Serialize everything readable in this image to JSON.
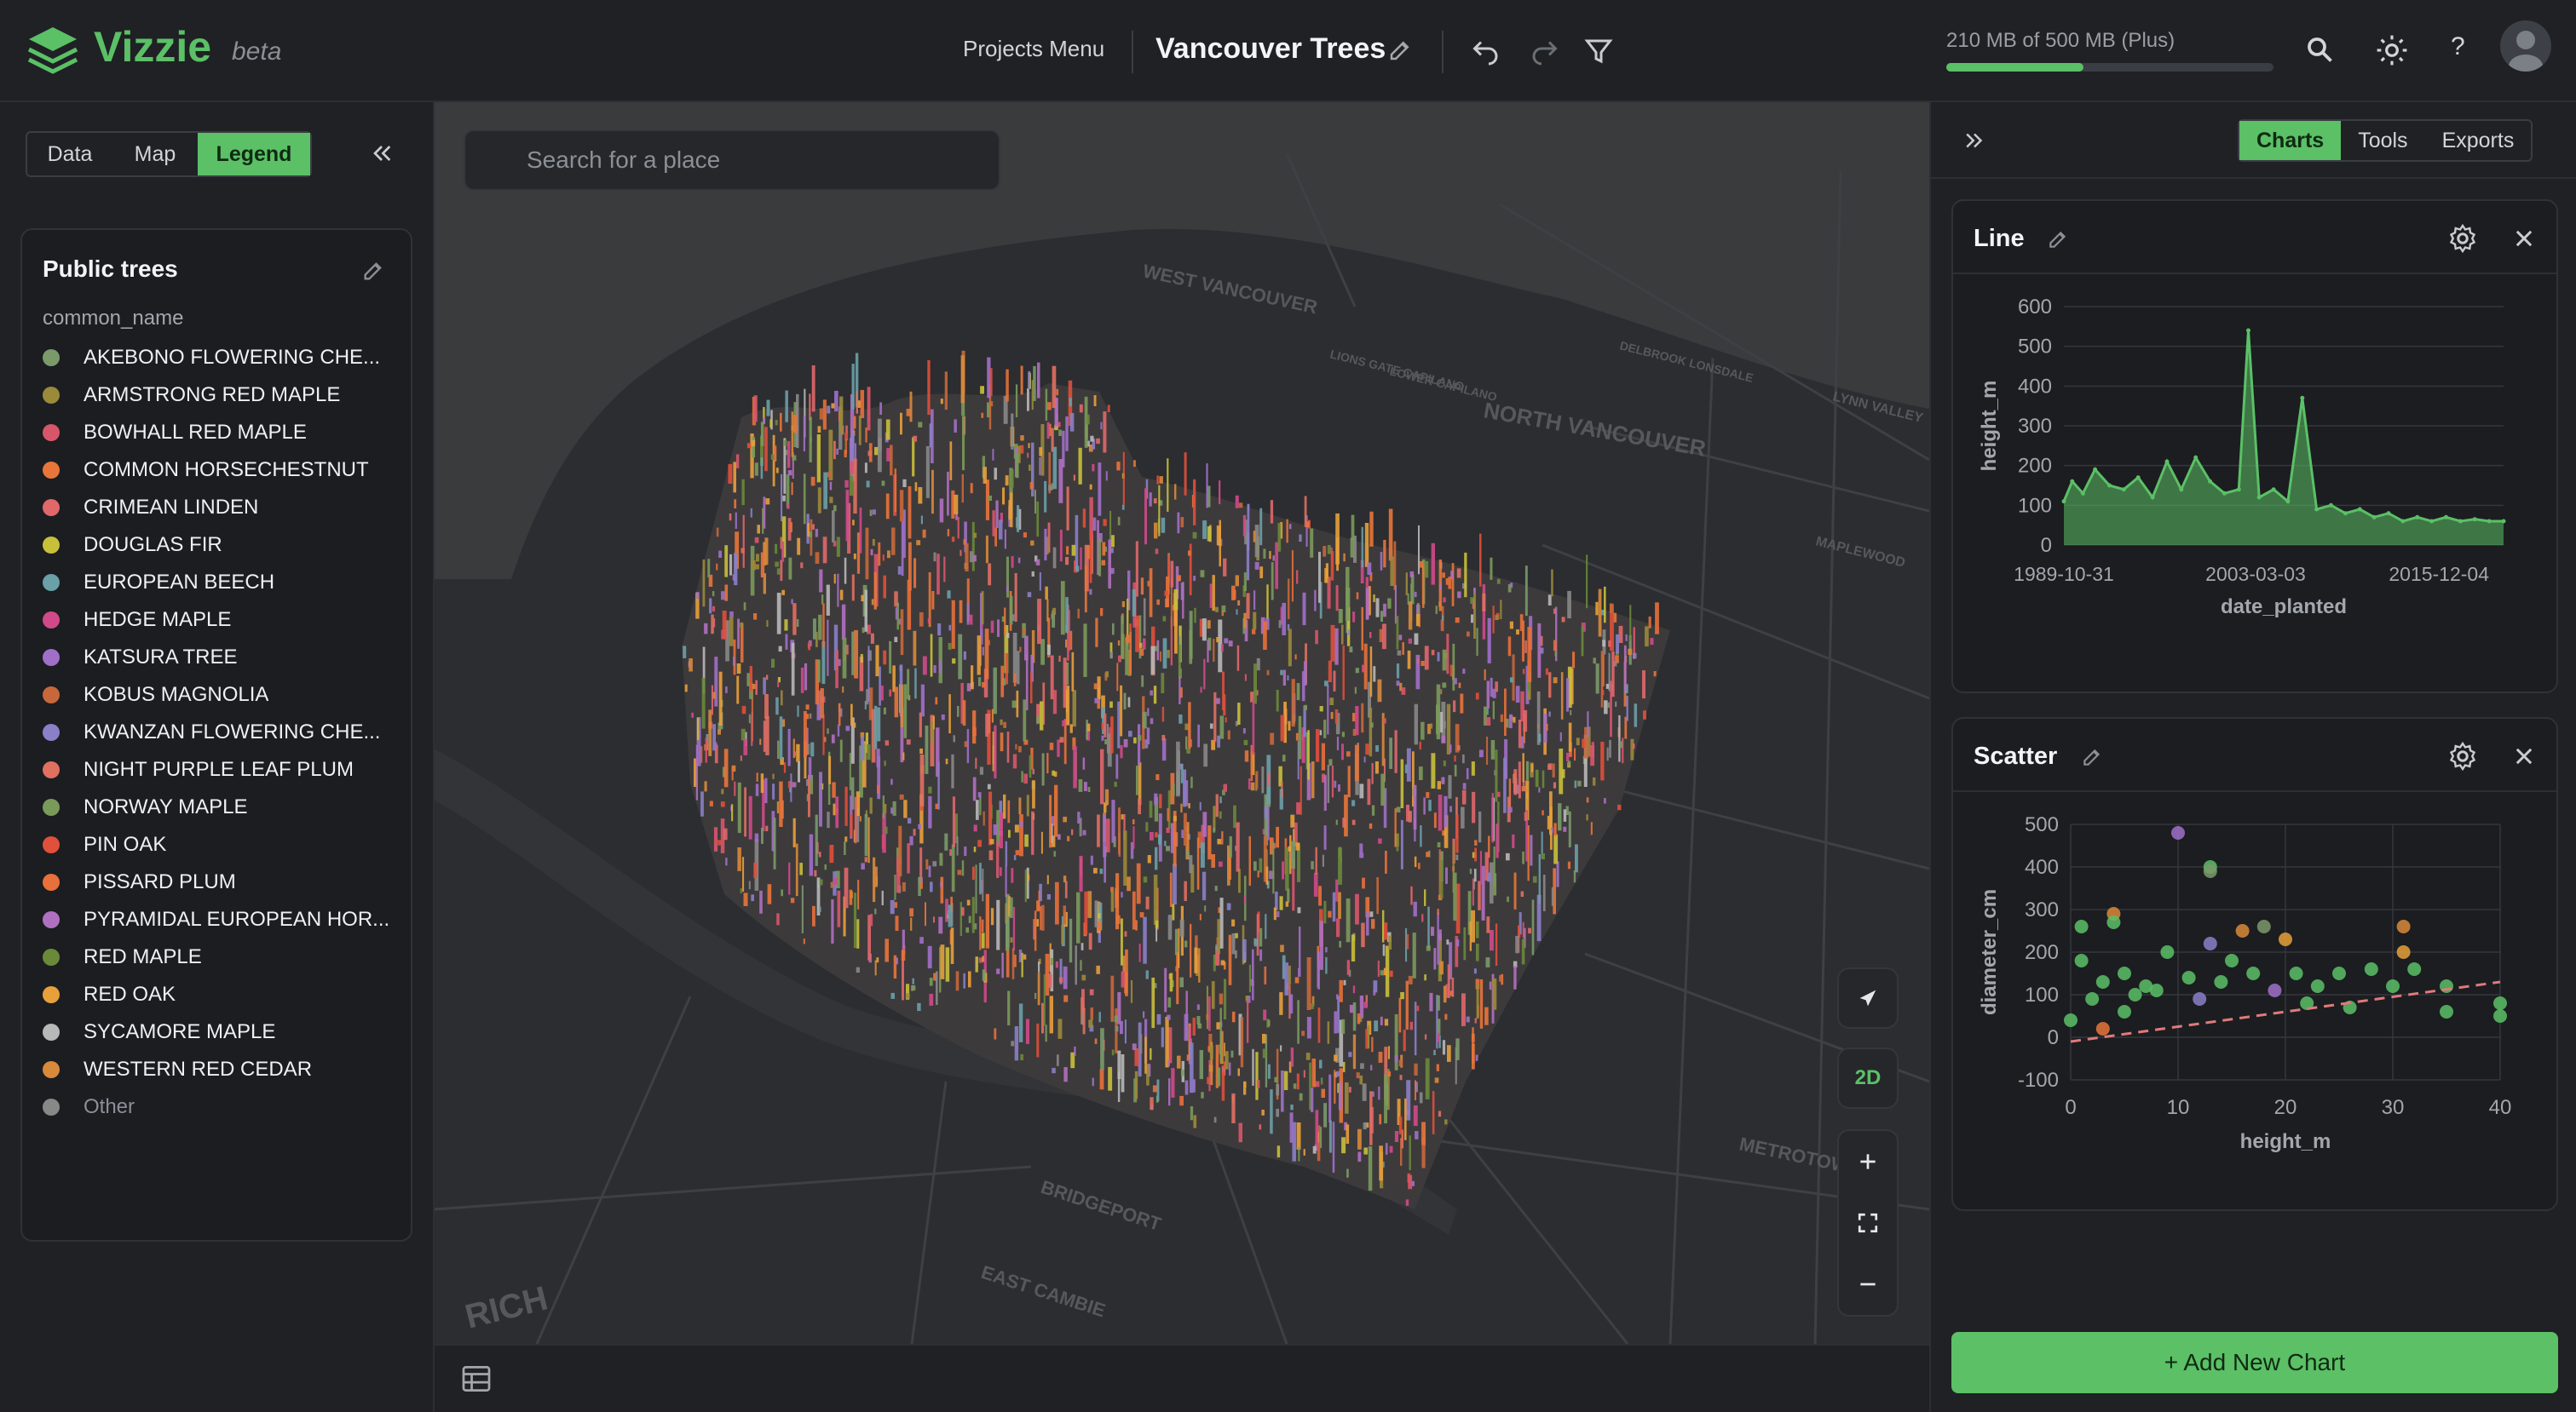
{
  "app": {
    "name": "Vizzie",
    "badge": "beta"
  },
  "header": {
    "projects_menu": "Projects Menu",
    "project_title": "Vancouver Trees",
    "storage_text": "210 MB of 500 MB (Plus)",
    "storage_used_fraction": 0.42
  },
  "left_tabs": [
    {
      "label": "Data",
      "active": false
    },
    {
      "label": "Map",
      "active": false
    },
    {
      "label": "Legend",
      "active": true
    }
  ],
  "legend": {
    "title": "Public trees",
    "field": "common_name",
    "items": [
      {
        "label": "AKEBONO FLOWERING CHE...",
        "color": "#7a9a6a"
      },
      {
        "label": "ARMSTRONG RED MAPLE",
        "color": "#9a8a3a"
      },
      {
        "label": "BOWHALL RED MAPLE",
        "color": "#d8566a"
      },
      {
        "label": "COMMON HORSECHESTNUT",
        "color": "#e8763a"
      },
      {
        "label": "CRIMEAN LINDEN",
        "color": "#e0686a"
      },
      {
        "label": "DOUGLAS FIR",
        "color": "#c8c03a"
      },
      {
        "label": "EUROPEAN BEECH",
        "color": "#6aa0a8"
      },
      {
        "label": "HEDGE MAPLE",
        "color": "#d04a8a"
      },
      {
        "label": "KATSURA TREE",
        "color": "#a070c8"
      },
      {
        "label": "KOBUS MAGNOLIA",
        "color": "#c8683a"
      },
      {
        "label": "KWANZAN FLOWERING CHE...",
        "color": "#8a80c8"
      },
      {
        "label": "NIGHT PURPLE LEAF PLUM",
        "color": "#e07060"
      },
      {
        "label": "NORWAY MAPLE",
        "color": "#7a9a5a"
      },
      {
        "label": "PIN OAK",
        "color": "#e0503a"
      },
      {
        "label": "PISSARD PLUM",
        "color": "#e8703a"
      },
      {
        "label": "PYRAMIDAL EUROPEAN HOR...",
        "color": "#b070c0"
      },
      {
        "label": "RED MAPLE",
        "color": "#6a8a3a"
      },
      {
        "label": "RED OAK",
        "color": "#e8a03a"
      },
      {
        "label": "SYCAMORE MAPLE",
        "color": "#b8b8b8"
      },
      {
        "label": "WESTERN RED CEDAR",
        "color": "#d88a3a"
      },
      {
        "label": "Other",
        "color": "#888888",
        "muted": true
      }
    ]
  },
  "map": {
    "search_placeholder": "Search for a place",
    "mode_label": "2D",
    "place_labels": [
      "WEST VANCOUVER",
      "NORTH VANCOUVER",
      "BRIDGEPORT",
      "EAST CAMBIE",
      "METROTOWN",
      "LYNN VALLEY",
      "MAPLEWOOD",
      "LOWER CAPILANO",
      "LIONS GATE CAPILANO",
      "DELBROOK LONSDALE",
      "RICH"
    ]
  },
  "right_tabs": [
    {
      "label": "Charts",
      "active": true
    },
    {
      "label": "Tools",
      "active": false
    },
    {
      "label": "Exports",
      "active": false
    }
  ],
  "add_chart_label": "+ Add New Chart",
  "chart_data": [
    {
      "type": "line",
      "title": "Line",
      "xlabel": "date_planted",
      "ylabel": "height_m",
      "x_ticks": [
        "1989-10-31",
        "2003-03-03",
        "2015-12-04"
      ],
      "y_ticks": [
        0,
        100,
        200,
        300,
        400,
        500,
        600
      ],
      "ylim": [
        0,
        600
      ],
      "color": "#5bc066",
      "series": [
        {
          "x": [
            "1989-10-31",
            "1990-06-01",
            "1991-03-01",
            "1992-01-01",
            "1993-01-01",
            "1994-01-01",
            "1995-01-01",
            "1996-01-01",
            "1997-01-01",
            "1998-01-01",
            "1999-01-01",
            "2000-01-01",
            "2001-01-01",
            "2002-01-01",
            "2002-09-01",
            "2003-06-01",
            "2004-06-01",
            "2005-06-01",
            "2006-06-01",
            "2007-06-01",
            "2008-06-01",
            "2009-06-01",
            "2010-06-01",
            "2011-06-01",
            "2012-06-01",
            "2013-06-01",
            "2014-06-01",
            "2015-06-01",
            "2016-06-01",
            "2017-06-01",
            "2018-06-01",
            "2019-06-01",
            "2020-06-01"
          ],
          "y": [
            110,
            160,
            130,
            190,
            150,
            140,
            170,
            120,
            210,
            140,
            220,
            160,
            130,
            140,
            540,
            120,
            140,
            110,
            370,
            90,
            100,
            80,
            90,
            70,
            80,
            60,
            70,
            60,
            70,
            60,
            65,
            60,
            60
          ]
        }
      ]
    },
    {
      "type": "scatter",
      "title": "Scatter",
      "xlabel": "height_m",
      "ylabel": "diameter_cm",
      "xlim": [
        0,
        40
      ],
      "ylim": [
        -100,
        500
      ],
      "x_ticks": [
        0,
        10,
        20,
        30,
        40
      ],
      "y_ticks": [
        -100,
        0,
        100,
        200,
        300,
        400,
        500
      ],
      "trend": {
        "x": [
          0,
          40
        ],
        "y": [
          -10,
          130
        ],
        "color": "#e07a7a"
      },
      "points": [
        {
          "x": 0,
          "y": 40,
          "color": "#5bc066"
        },
        {
          "x": 1,
          "y": 260,
          "color": "#5bc066"
        },
        {
          "x": 1,
          "y": 180,
          "color": "#5bc066"
        },
        {
          "x": 2,
          "y": 90,
          "color": "#5bc066"
        },
        {
          "x": 3,
          "y": 130,
          "color": "#5bc066"
        },
        {
          "x": 3,
          "y": 20,
          "color": "#e8763a"
        },
        {
          "x": 4,
          "y": 290,
          "color": "#d88a3a"
        },
        {
          "x": 4,
          "y": 270,
          "color": "#5bc066"
        },
        {
          "x": 5,
          "y": 60,
          "color": "#5bc066"
        },
        {
          "x": 5,
          "y": 150,
          "color": "#5bc066"
        },
        {
          "x": 6,
          "y": 100,
          "color": "#5bc066"
        },
        {
          "x": 7,
          "y": 120,
          "color": "#5bc066"
        },
        {
          "x": 8,
          "y": 110,
          "color": "#5bc066"
        },
        {
          "x": 9,
          "y": 200,
          "color": "#5bc066"
        },
        {
          "x": 10,
          "y": 480,
          "color": "#a070c8"
        },
        {
          "x": 11,
          "y": 140,
          "color": "#5bc066"
        },
        {
          "x": 12,
          "y": 90,
          "color": "#8a80c8"
        },
        {
          "x": 13,
          "y": 400,
          "color": "#5bc066"
        },
        {
          "x": 13,
          "y": 390,
          "color": "#7a9a6a"
        },
        {
          "x": 13,
          "y": 220,
          "color": "#8a80c8"
        },
        {
          "x": 14,
          "y": 130,
          "color": "#5bc066"
        },
        {
          "x": 15,
          "y": 180,
          "color": "#5bc066"
        },
        {
          "x": 16,
          "y": 250,
          "color": "#d88a3a"
        },
        {
          "x": 17,
          "y": 150,
          "color": "#5bc066"
        },
        {
          "x": 18,
          "y": 260,
          "color": "#7a9a6a"
        },
        {
          "x": 19,
          "y": 110,
          "color": "#a070c8"
        },
        {
          "x": 20,
          "y": 230,
          "color": "#e8a03a"
        },
        {
          "x": 21,
          "y": 150,
          "color": "#5bc066"
        },
        {
          "x": 22,
          "y": 80,
          "color": "#5bc066"
        },
        {
          "x": 23,
          "y": 120,
          "color": "#5bc066"
        },
        {
          "x": 25,
          "y": 150,
          "color": "#5bc066"
        },
        {
          "x": 26,
          "y": 70,
          "color": "#5bc066"
        },
        {
          "x": 28,
          "y": 160,
          "color": "#5bc066"
        },
        {
          "x": 30,
          "y": 120,
          "color": "#5bc066"
        },
        {
          "x": 31,
          "y": 260,
          "color": "#d88a3a"
        },
        {
          "x": 31,
          "y": 200,
          "color": "#e8a03a"
        },
        {
          "x": 32,
          "y": 160,
          "color": "#5bc066"
        },
        {
          "x": 35,
          "y": 60,
          "color": "#5bc066"
        },
        {
          "x": 35,
          "y": 120,
          "color": "#5bc066"
        },
        {
          "x": 40,
          "y": 80,
          "color": "#5bc066"
        },
        {
          "x": 40,
          "y": 50,
          "color": "#5bc066"
        }
      ]
    }
  ]
}
